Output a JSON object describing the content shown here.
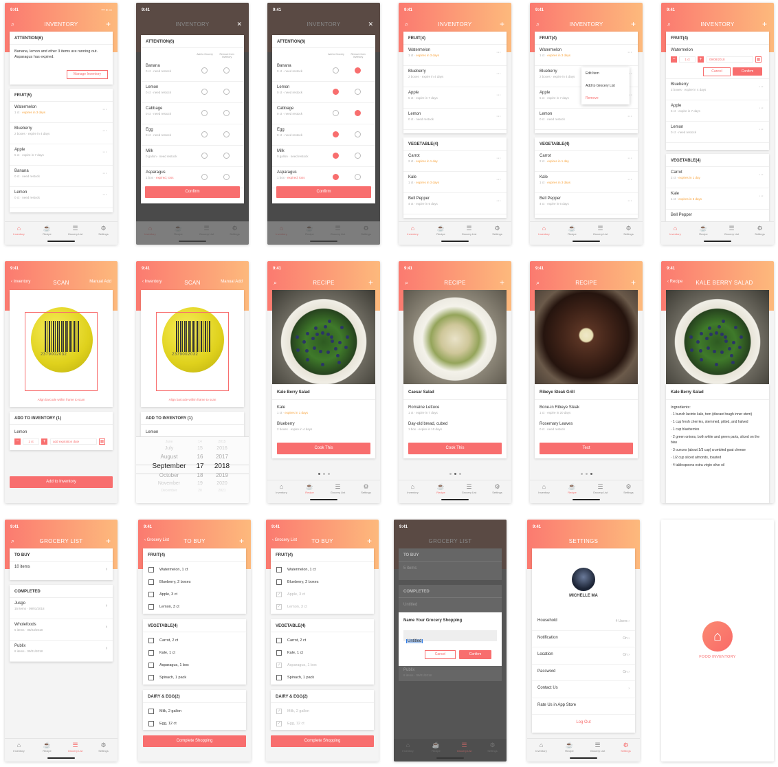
{
  "status": {
    "time": "9:41",
    "icons": "••• ≡ ▭"
  },
  "tabs": [
    {
      "label": "Inventory",
      "icon": "⌂"
    },
    {
      "label": "Recipe",
      "icon": "☕"
    },
    {
      "label": "Grocery List",
      "icon": "☰"
    },
    {
      "label": "Settings",
      "icon": "⚙"
    }
  ],
  "common": {
    "plus": "+",
    "search": "⌕",
    "more": "···",
    "back": "‹",
    "close": "✕",
    "arrow": "›"
  },
  "s1": {
    "title": "INVENTORY",
    "att_head": "ATTENTION(6)",
    "att_text": "Banana, lemon and other 3 items are running out. Asparagus has expired.",
    "manage": "Manage Inventory",
    "fruit_head": "FRUIT(5)",
    "items": [
      {
        "n": "Watermelon",
        "s": "1 ct · ",
        "w": "expires in 3 days"
      },
      {
        "n": "Blueberry",
        "s": "2 boxes · expire in 4 days"
      },
      {
        "n": "Apple",
        "s": "5 ct · expire in 7 days"
      },
      {
        "n": "Banana",
        "s": "0 ct · need restock"
      },
      {
        "n": "Lemon",
        "s": "0 ct · need restock"
      }
    ]
  },
  "att": {
    "title": "INVENTORY",
    "head": "ATTENTION(6)",
    "col1": "Add to Grocery",
    "col2": "Remove from Inventory",
    "confirm": "Confirm",
    "items": [
      {
        "n": "Banana",
        "s": "0 ct · need restock"
      },
      {
        "n": "Lemon",
        "s": "0 ct · need restock"
      },
      {
        "n": "Cabbage",
        "s": "0 ct · need restock"
      },
      {
        "n": "Egg",
        "s": "0 ct · need restock"
      },
      {
        "n": "Milk",
        "s": "0 gallon · need restock"
      },
      {
        "n": "Asparagus",
        "s": "1 box · ",
        "e": "expired, toss"
      }
    ]
  },
  "s4": {
    "title": "INVENTORY",
    "fruit_head": "FRUIT(4)",
    "veg_head": "VEGETABLE(4)",
    "fruit": [
      {
        "n": "Watermelon",
        "s": "1 ct · ",
        "w": "expires in 3 days"
      },
      {
        "n": "Blueberry",
        "s": "2 boxes · expire in 4 days"
      },
      {
        "n": "Apple",
        "s": "5 ct · expire in 7 days"
      },
      {
        "n": "Lemon",
        "s": "0 ct · need restock"
      }
    ],
    "veg": [
      {
        "n": "Carrot",
        "s": "2 ct · ",
        "w": "expires in 1 day"
      },
      {
        "n": "Kale",
        "s": "1 ct · ",
        "w": "expires in 3 days"
      },
      {
        "n": "Bell Pepper",
        "s": "4 ct · expire in 6 days"
      }
    ],
    "menu": [
      "Edit Item",
      "Add to Grocery List",
      "Remove"
    ]
  },
  "s6": {
    "qty": "1 ct",
    "minus": "−",
    "date": "09/08/2018",
    "cancel": "Cancel",
    "confirm": "Confirm",
    "veg_peek": "Bell Pepper"
  },
  "scan": {
    "back": "Inventory",
    "title": "SCAN",
    "manual": "Manual Add",
    "barcode": "2379002032",
    "hint": "Align barcode within frame to scan",
    "add_head": "ADD TO INVENTORY (1)",
    "item": "Lemon",
    "qty": "1 ct",
    "date_ph": "add expiration date",
    "add_btn": "Add to Inventory",
    "picker": {
      "months": [
        "July",
        "August",
        "September",
        "October",
        "November"
      ],
      "days": [
        "15",
        "16",
        "17",
        "18",
        "19"
      ],
      "years": [
        "2016",
        "2017",
        "2018",
        "2019",
        "2020"
      ],
      "top": [
        "June",
        "14",
        "2015"
      ],
      "bottom": [
        "December",
        "20",
        "2021"
      ]
    }
  },
  "recipes": [
    {
      "title": "RECIPE",
      "name": "Kale Berry Salad",
      "i1": "Kale",
      "s1": "1 ct · ",
      "w1": "expires in 1 days",
      "i2": "Blueberry",
      "s2": "2 boxes · expire in 4 days",
      "btn": "Cook This"
    },
    {
      "title": "RECIPE",
      "name": "Caesar Salad",
      "i1": "Romaine Lettuce",
      "s1": "1 ct · expire in 7 days",
      "w1": "",
      "i2": "Day-old bread, cubed",
      "s2": "1 box · expire in 10 days",
      "btn": "Cook This"
    },
    {
      "title": "RECIPE",
      "name": "Ribeye Steak Grill",
      "i1": "Bone-in Ribeye Steak",
      "s1": "1 ct · expire in 20 days",
      "w1": "",
      "i2": "Rosemary Leaves",
      "s2": "0 ct · need restock",
      "btn": "Text"
    }
  ],
  "detail": {
    "back": "Recipe",
    "title": "KALE BERRY SALAD",
    "name": "Kale Berry Salad",
    "ing_head": "Ingredients:",
    "ings": [
      "· 1 bunch lacinto kale, torn (discard tough inner stem)",
      "· 1 cup fresh cherries, stemmed, pitted, and halved",
      "· 1 cup blueberries",
      "· 2 green onions, both white and green parts, sliced on the bias",
      "· 3 ounces (about 1/3 cup) crumbled goat cheese",
      "· 1/2 cup sliced almonds, toasted",
      "· 4 tablespoons extra virgin olive oil"
    ]
  },
  "gl": {
    "title": "GROCERY LIST",
    "to_buy": "TO BUY",
    "items_count": "10 items",
    "completed": "COMPLETED",
    "done": [
      {
        "n": "Jusgo",
        "s": "15 items · 09/01/2018"
      },
      {
        "n": "Wholefoods",
        "s": "5 items · 08/23/2018"
      },
      {
        "n": "Publix",
        "s": "8 items · 09/01/2018"
      }
    ]
  },
  "tobuy": {
    "back": "Grocery List",
    "title": "TO BUY",
    "fruit_head": "FRUIT(4)",
    "veg_head": "VEGETABLE(4)",
    "dairy_head": "DAIRY & EGG(2)",
    "complete": "Complete Shopping",
    "fruit": [
      "Watermelon, 1 ct",
      "Blueberry, 2 boxes",
      "Apple, 3 ct",
      "Lemon, 3 ct"
    ],
    "veg": [
      "Carrot, 2 ct",
      "Kale, 1 ct",
      "Asparagus, 1 box",
      "Spinach, 1 pack"
    ],
    "dairy": [
      "Milk, 2 gallon",
      "Egg, 12 ct"
    ]
  },
  "dlg": {
    "title": "GROCERY LIST",
    "to_buy": "TO BUY",
    "count": "5 items",
    "completed": "COMPLETED",
    "peek": "Untitled",
    "peek2": "Publix",
    "peek2s": "8 items · 09/01/2018",
    "head": "Name Your Grocery Shopping",
    "value": "Untitled",
    "cancel": "Cancel",
    "confirm": "Confirm"
  },
  "settings": {
    "title": "SETTINGS",
    "user": "MICHELLE MA",
    "rows": [
      {
        "n": "Household",
        "v": "4 Users"
      },
      {
        "n": "Notification",
        "v": "On"
      },
      {
        "n": "Location",
        "v": "On"
      },
      {
        "n": "Password",
        "v": "On"
      },
      {
        "n": "Contact Us",
        "v": ""
      },
      {
        "n": "Rate Us in App Store",
        "v": ""
      }
    ],
    "logout": "Log Out"
  },
  "splash": {
    "app": "FOOD INVENTORY"
  },
  "colors": {
    "accent": "#f86e6e",
    "warn": "#f8a33c",
    "grad_start": "#fb7a70",
    "grad_end": "#fdb97c"
  }
}
